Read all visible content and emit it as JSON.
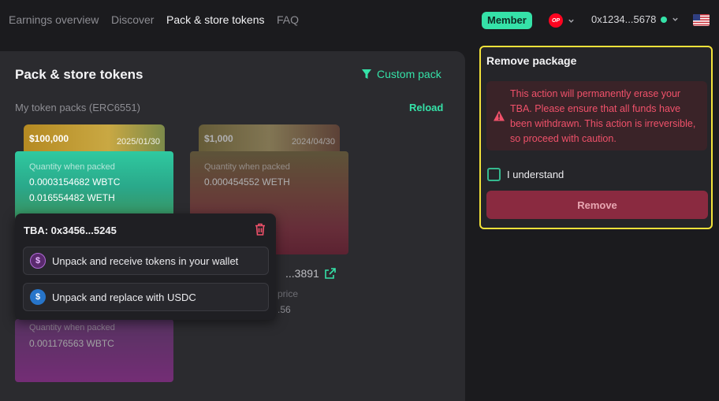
{
  "nav": {
    "items": [
      {
        "label": "Earnings overview"
      },
      {
        "label": "Discover"
      },
      {
        "label": "Pack & store tokens"
      },
      {
        "label": "FAQ"
      }
    ],
    "member_label": "Member",
    "chain_icon_text": "OP",
    "wallet_address": "0x1234...5678",
    "chain_icon": "optimism-icon",
    "flag_icon": "us-flag-icon"
  },
  "main": {
    "title": "Pack & store tokens",
    "custom_pack_label": "Custom pack",
    "section_label": "My token packs (ERC6551)",
    "reload_label": "Reload",
    "cards": [
      {
        "amount": "$100,000",
        "date": "2025/01/30",
        "qty_label": "Quantity when packed",
        "tokens": [
          "0.0003154682 WBTC",
          "0.016554482 WETH"
        ]
      },
      {
        "amount": "$1,000",
        "date": "2024/04/30",
        "qty_label": "Quantity when packed",
        "tokens": [
          "0.000454552 WETH"
        ],
        "tba_partial": "...3891",
        "price_partial": "price",
        "price_value_partial": ".56"
      },
      {
        "qty_label": "Quantity when packed",
        "tokens": [
          "0.001176563 WBTC"
        ]
      }
    ]
  },
  "popover": {
    "title": "TBA: 0x3456...5245",
    "options": [
      {
        "label": "Unpack and receive tokens in your wallet",
        "icon": "wallet-coin-icon"
      },
      {
        "label": "Unpack and replace with USDC",
        "icon": "usdc-icon"
      }
    ]
  },
  "remove_panel": {
    "title": "Remove package",
    "warning": "This action will permanently erase your TBA. Please ensure that all funds have been withdrawn. This action is irreversible, so proceed with caution.",
    "checkbox_label": "I understand",
    "remove_label": "Remove"
  },
  "colors": {
    "accent": "#35e2a8",
    "danger": "#f0516a",
    "highlight_border": "#f2e23a"
  }
}
